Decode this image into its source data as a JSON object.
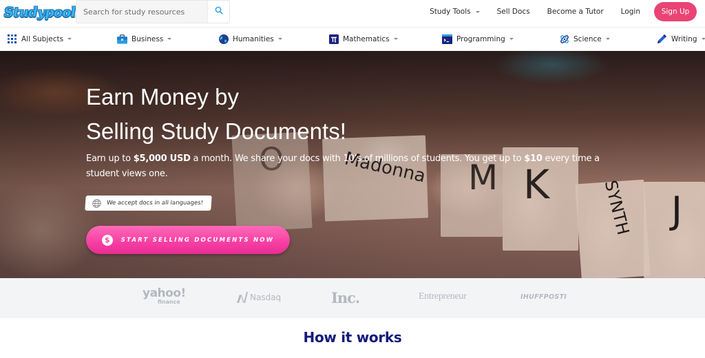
{
  "header": {
    "logo_text": "Studypool",
    "search": {
      "placeholder": "Search for study resources",
      "value": "",
      "icon": "search-icon"
    },
    "nav": [
      {
        "label": "Study Tools",
        "has_dropdown": true
      },
      {
        "label": "Sell Docs",
        "has_dropdown": false
      },
      {
        "label": "Become a Tutor",
        "has_dropdown": false
      },
      {
        "label": "Login",
        "has_dropdown": false
      }
    ],
    "signup_label": "Sign Up"
  },
  "subjects": [
    {
      "label": "All Subjects",
      "icon": "grid-icon"
    },
    {
      "label": "Business",
      "icon": "briefcase-icon"
    },
    {
      "label": "Humanities",
      "icon": "globe-icon"
    },
    {
      "label": "Mathematics",
      "icon": "pi-icon"
    },
    {
      "label": "Programming",
      "icon": "terminal-icon"
    },
    {
      "label": "Science",
      "icon": "atom-icon"
    },
    {
      "label": "Writing",
      "icon": "pen-icon"
    }
  ],
  "hero": {
    "title_line1": "Earn Money by",
    "title_line2": "Selling Study Documents!",
    "subtitle": {
      "part1": "Earn up to ",
      "bold1": "$5,000 USD",
      "part2": " a month. We share your docs with 10’s of millions of students. You get up to ",
      "bold2": "$10",
      "part3": " every time a student views one."
    },
    "language_badge": "We accept docs in all languages!",
    "cta_label": "START SELLING DOCUMENTS NOW",
    "cta_icon": "dollar-icon",
    "tab_letters": [
      "O",
      "Madonna",
      "M",
      "K",
      "SYNTH",
      "J"
    ]
  },
  "press": {
    "logos": [
      {
        "name": "yahoo",
        "text": "yahoo!",
        "sub": "finance"
      },
      {
        "name": "nasdaq",
        "text": "Nasdaq"
      },
      {
        "name": "inc",
        "text": "Inc."
      },
      {
        "name": "entrepreneur",
        "text": "Entrepreneur"
      },
      {
        "name": "huffpost",
        "text": "IHUFFPOSTI"
      }
    ]
  },
  "how_it_works": {
    "title": "How it works"
  },
  "colors": {
    "brand_blue": "#3cb4f0",
    "signup_pink": "#ea4474",
    "cta_pink": "#f73ea3",
    "heading_navy": "#131a7a",
    "press_bg": "#f3f4f6",
    "press_logo_gray": "#b4b8bf"
  }
}
